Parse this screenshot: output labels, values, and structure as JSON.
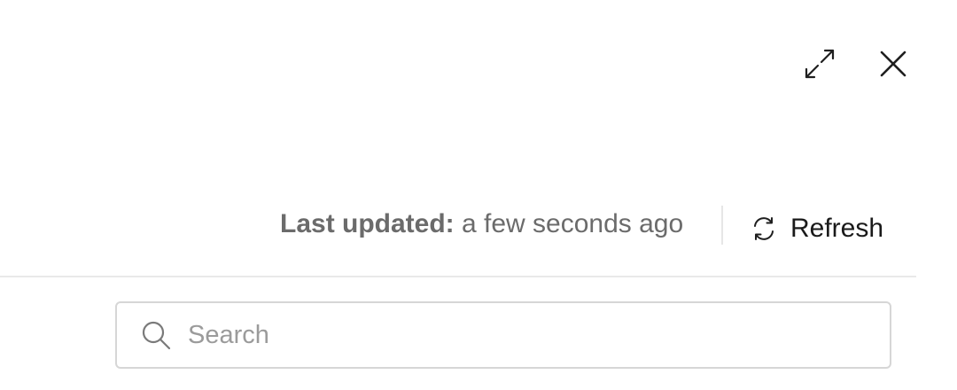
{
  "header": {
    "icons": [
      "expand-icon",
      "close-icon"
    ]
  },
  "status": {
    "last_updated_label": "Last updated:",
    "last_updated_value": "a few seconds ago",
    "refresh_label": "Refresh",
    "refresh_icon": "refresh-icon"
  },
  "search": {
    "value": "",
    "placeholder": "Search",
    "icon": "search-icon"
  },
  "colors": {
    "text_muted": "#6b6b6b",
    "text_primary": "#1a1a1a",
    "border": "#d6d6d6",
    "divider": "#e9e9e9",
    "placeholder": "#9b9b9b"
  }
}
